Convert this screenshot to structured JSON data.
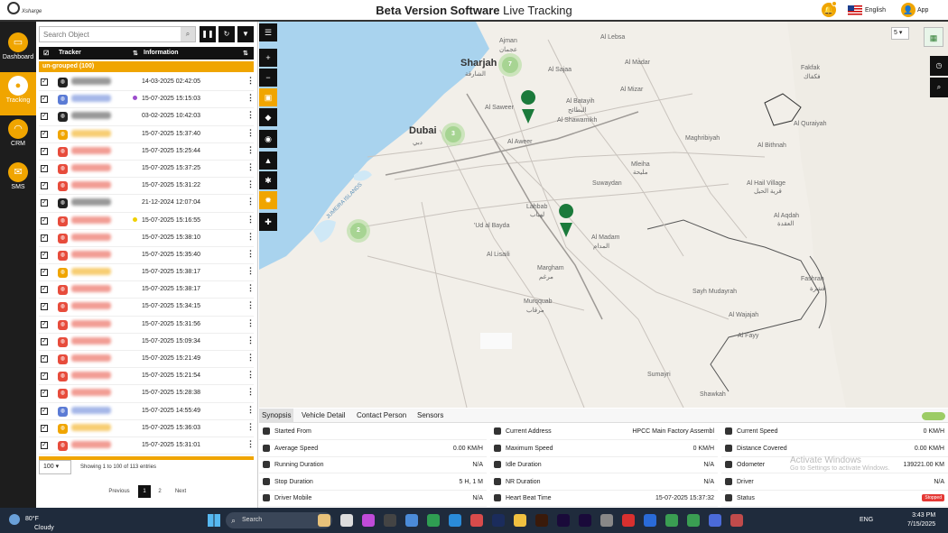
{
  "header": {
    "title_bold": "Beta Version Software",
    "title_rest": " Live Tracking",
    "logo_text": "Xsharge",
    "language": "English",
    "user": "App"
  },
  "nav": [
    {
      "label": "Dashboard",
      "icon": "monitor-icon"
    },
    {
      "label": "Tracking",
      "icon": "location-pin-icon"
    },
    {
      "label": "CRM",
      "icon": "headset-icon"
    },
    {
      "label": "SMS",
      "icon": "envelope-icon"
    }
  ],
  "panel": {
    "search_placeholder": "Search Object",
    "col_tracker": "Tracker",
    "col_info": "Information",
    "group": "un-grouped (100)",
    "rows": [
      {
        "color": "#222",
        "name_color": "#444",
        "info": "14-03-2025 02:42:05",
        "dot": ""
      },
      {
        "color": "#5b7bd5",
        "name_color": "#5b7bd5",
        "info": "15-07-2025 15:15:03",
        "dot": "#9c4dcc"
      },
      {
        "color": "#222",
        "name_color": "#444",
        "info": "03-02-2025 10:42:03",
        "dot": ""
      },
      {
        "color": "#f0a500",
        "name_color": "#f0a500",
        "info": "15-07-2025 15:37:40",
        "dot": ""
      },
      {
        "color": "#e74c3c",
        "name_color": "#e74c3c",
        "info": "15-07-2025 15:25:44",
        "dot": ""
      },
      {
        "color": "#e74c3c",
        "name_color": "#e74c3c",
        "info": "15-07-2025 15:37:25",
        "dot": ""
      },
      {
        "color": "#e74c3c",
        "name_color": "#e74c3c",
        "info": "15-07-2025 15:31:22",
        "dot": ""
      },
      {
        "color": "#222",
        "name_color": "#444",
        "info": "21-12-2024 12:07:04",
        "dot": ""
      },
      {
        "color": "#e74c3c",
        "name_color": "#e74c3c",
        "info": "15-07-2025 15:16:55",
        "dot": "#f0d000"
      },
      {
        "color": "#e74c3c",
        "name_color": "#e74c3c",
        "info": "15-07-2025 15:38:10",
        "dot": ""
      },
      {
        "color": "#e74c3c",
        "name_color": "#e74c3c",
        "info": "15-07-2025 15:35:40",
        "dot": ""
      },
      {
        "color": "#f0a500",
        "name_color": "#f0a500",
        "info": "15-07-2025 15:38:17",
        "dot": ""
      },
      {
        "color": "#e74c3c",
        "name_color": "#e74c3c",
        "info": "15-07-2025 15:38:17",
        "dot": ""
      },
      {
        "color": "#e74c3c",
        "name_color": "#e74c3c",
        "info": "15-07-2025 15:34:15",
        "dot": ""
      },
      {
        "color": "#e74c3c",
        "name_color": "#e74c3c",
        "info": "15-07-2025 15:31:56",
        "dot": ""
      },
      {
        "color": "#e74c3c",
        "name_color": "#e74c3c",
        "info": "15-07-2025 15:09:34",
        "dot": ""
      },
      {
        "color": "#e74c3c",
        "name_color": "#e74c3c",
        "info": "15-07-2025 15:21:49",
        "dot": ""
      },
      {
        "color": "#e74c3c",
        "name_color": "#e74c3c",
        "info": "15-07-2025 15:21:54",
        "dot": ""
      },
      {
        "color": "#e74c3c",
        "name_color": "#e74c3c",
        "info": "15-07-2025 15:28:38",
        "dot": ""
      },
      {
        "color": "#5b7bd5",
        "name_color": "#5b7bd5",
        "info": "15-07-2025 14:55:49",
        "dot": ""
      },
      {
        "color": "#f0a500",
        "name_color": "#f0a500",
        "info": "15-07-2025 15:36:03",
        "dot": ""
      },
      {
        "color": "#e74c3c",
        "name_color": "#e74c3c",
        "info": "15-07-2025 15:31:01",
        "dot": ""
      }
    ],
    "page_size": "100",
    "entries": "Showing 1 to 100 of 113 entries",
    "prev": "Previous",
    "page1": "1",
    "page2": "2",
    "next": "Next"
  },
  "map": {
    "zoom": "5",
    "labels": {
      "sharjah": "Sharjah",
      "sharjah_ar": "الشارقة",
      "dubai": "Dubai",
      "dubai_ar": "دبي",
      "ajman": "Ajman",
      "ajman_ar": "عجمان",
      "al_aweer": "Al Aweer",
      "lahbab": "Lahbab",
      "lahbab_ar": "لهباب",
      "ud_al_bayda": "'Ud al Bayda",
      "al_lisaili": "Al Lisaili",
      "margham": "Margham",
      "margham_ar": "مرغم",
      "murquab": "Murqquab",
      "murquab_ar": "مرقاب",
      "al_madam": "Al Madam",
      "al_madam_ar": "المدام",
      "maghribiyah": "Maghribiyah",
      "mileiha": "Mleiha",
      "mileiha_ar": "مليحة",
      "suwaydan": "Suwaydan",
      "al_hail": "Al Hail Village",
      "al_hail_ar": "قرية الحيل",
      "al_aqdah": "Al Aqdah",
      "al_aqdah_ar": "العقدة",
      "fashrah": "Fashrah",
      "fashrah_ar": "فشرة",
      "sayh": "Sayh Mudayrah",
      "al_wajaa": "Al Wajajah",
      "al_fayy": "Al Fayy",
      "sumayri": "Sumayri",
      "shawkah": "Shawkah",
      "al_bithnah": "Al Bithnah",
      "al_qurayyah": "Al Quraiyah",
      "fakfak": "Fakfak",
      "fakfak_ar": "فكفاك",
      "al_batayih": "Al Batayih",
      "al_batayih_ar": "البطائح",
      "al_lebsa": "Al Lebsa",
      "al_madar": "Al Madar",
      "al_mizar": "Al Mizar",
      "al_sajaa": "Al Sajaa",
      "shawamikh": "Al Shawamikh",
      "al_madam2": "Al Saweer",
      "islands": "JUMEIRA ISLANDS"
    },
    "clusters": [
      "7",
      "3",
      "2"
    ]
  },
  "tabs": [
    "Synopsis",
    "Vehicle Detail",
    "Contact Person",
    "Sensors"
  ],
  "details": [
    [
      {
        "label": "Started From",
        "value": ""
      },
      {
        "label": "Average Speed",
        "value": "0.00 KM/H"
      },
      {
        "label": "Running Duration",
        "value": "N/A"
      },
      {
        "label": "Stop Duration",
        "value": "5 H, 1 M"
      },
      {
        "label": "Driver Mobile",
        "value": "N/A"
      }
    ],
    [
      {
        "label": "Current Address",
        "value": "HPCC Main Factory Assembl"
      },
      {
        "label": "Maximum Speed",
        "value": "0 KM/H"
      },
      {
        "label": "Idle Duration",
        "value": "N/A"
      },
      {
        "label": "NR Duration",
        "value": "N/A"
      },
      {
        "label": "Heart Beat Time",
        "value": "15-07-2025 15:37:32"
      }
    ],
    [
      {
        "label": "Current Speed",
        "value": "0 KM/H"
      },
      {
        "label": "Distance Covered",
        "value": "0.00 KM/H"
      },
      {
        "label": "Odometer",
        "value": "139221.00 KM"
      },
      {
        "label": "Driver",
        "value": "N/A"
      },
      {
        "label": "Status",
        "value": "Stopped"
      }
    ]
  ],
  "windows": {
    "activate_title": "Activate Windows",
    "activate_sub": "Go to Settings to activate Windows.",
    "temp": "80°F",
    "cond": "Cloudy",
    "search": "Search",
    "lang": "ENG",
    "time": "3:43 PM",
    "date": "7/15/2025"
  }
}
